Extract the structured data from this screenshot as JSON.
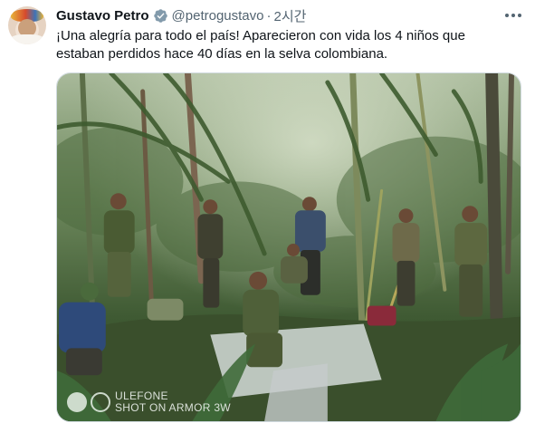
{
  "tweet": {
    "author_name": "Gustavo Petro",
    "author_handle": "@petrogustavo",
    "separator": "·",
    "timestamp": "2시간",
    "text_line1": "¡Una alegría para todo el país! Aparecieron con vida los 4 niños que",
    "text_line2": "estaban perdidos hace 40 días en la selva colombiana."
  },
  "media": {
    "watermark_line1": "ULEFONE",
    "watermark_line2": "SHOT ON ARMOR 3W"
  },
  "colors": {
    "text_primary": "#0f1419",
    "text_secondary": "#536471",
    "verified_badge": "#829aab",
    "border": "#cfd9de"
  },
  "icons": {
    "verified": "verified-badge-icon",
    "more": "more-options-icon"
  }
}
